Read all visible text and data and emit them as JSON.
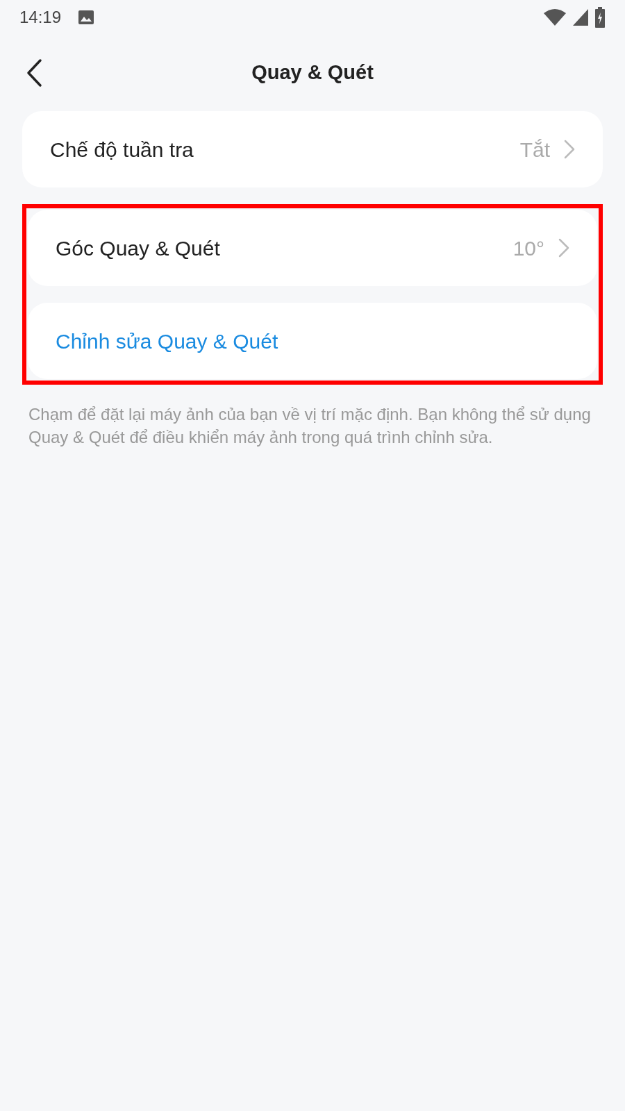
{
  "status_bar": {
    "time": "14:19"
  },
  "header": {
    "title": "Quay & Quét"
  },
  "settings": [
    {
      "kind": "value",
      "label": "Chế độ tuần tra",
      "value": "Tắt",
      "highlighted": false
    },
    {
      "kind": "value",
      "label": "Góc Quay & Quét",
      "value": "10°",
      "highlighted": true
    },
    {
      "kind": "action",
      "label": "Chỉnh sửa Quay & Quét",
      "highlighted": true
    }
  ],
  "footnote": "Chạm để đặt lại máy ảnh của bạn về vị trí mặc định. Bạn không thể sử dụng Quay & Quét để điều khiển máy ảnh trong quá trình chỉnh sửa."
}
